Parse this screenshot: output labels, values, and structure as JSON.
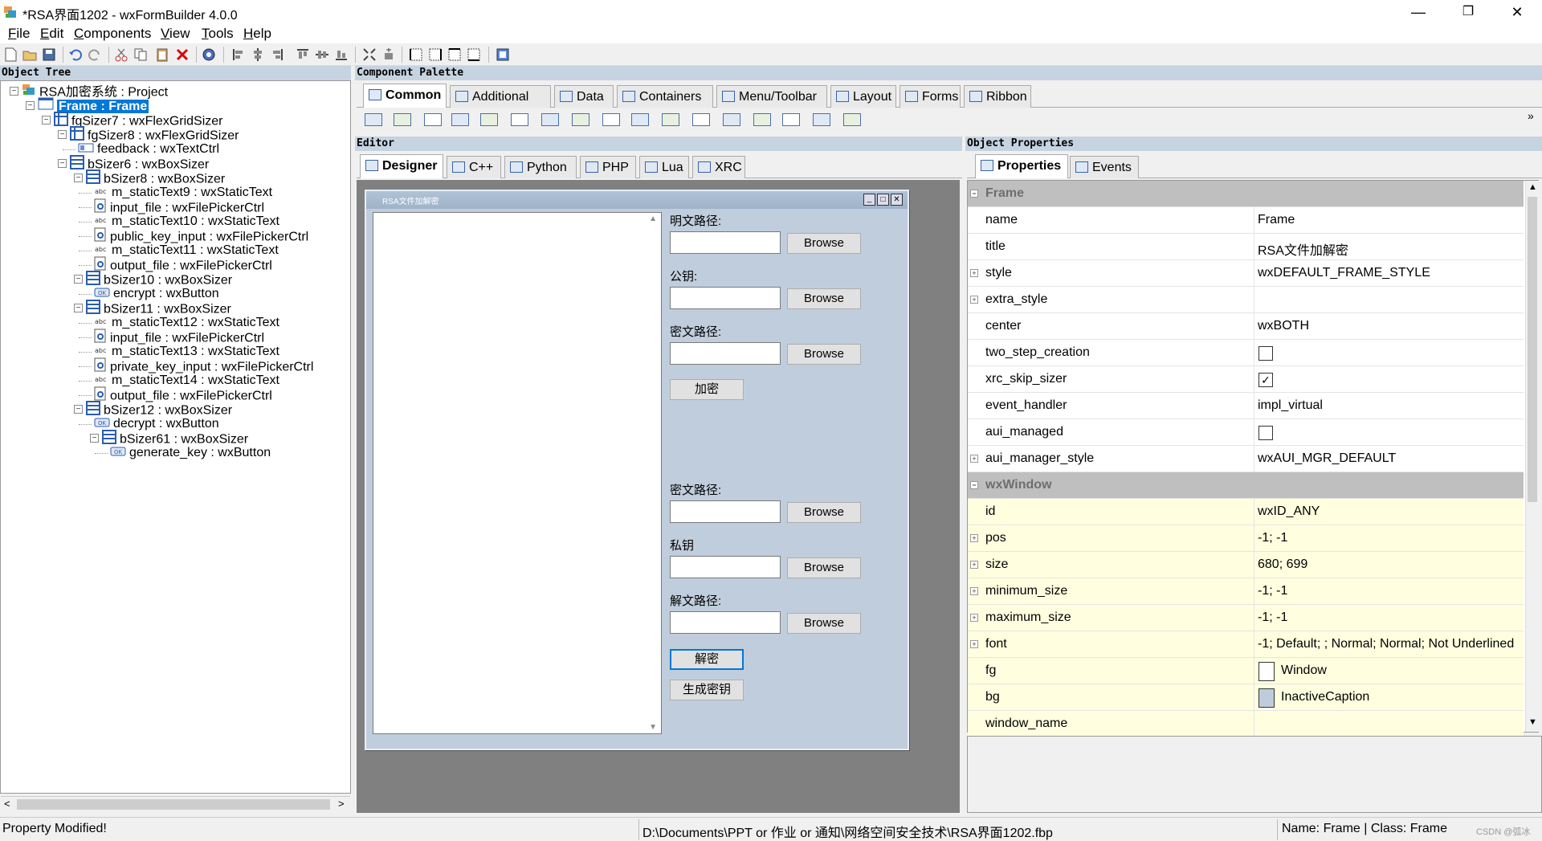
{
  "window": {
    "title": "*RSA界面1202 - wxFormBuilder 4.0.0",
    "min": "—",
    "max": "❐",
    "close": "✕"
  },
  "menu": [
    {
      "label": "File",
      "key": "F",
      "rest": "ile"
    },
    {
      "label": "Edit",
      "key": "E",
      "rest": "dit"
    },
    {
      "label": "Components",
      "key": "C",
      "rest": "omponents"
    },
    {
      "label": "View",
      "key": "V",
      "rest": "iew"
    },
    {
      "label": "Tools",
      "key": "T",
      "rest": "ools"
    },
    {
      "label": "Help",
      "key": "H",
      "rest": "elp"
    }
  ],
  "panels": {
    "object_tree": "Object Tree",
    "palette": "Component Palette",
    "editor": "Editor",
    "properties": "Object Properties"
  },
  "tree": [
    {
      "label": "RSA加密系统 : Project",
      "icon": "project-icon"
    },
    {
      "label": "Frame : Frame",
      "icon": "frame-icon"
    },
    {
      "label": "fgSizer7 : wxFlexGridSizer",
      "icon": "flexgrid-icon"
    },
    {
      "label": "fgSizer8 : wxFlexGridSizer",
      "icon": "flexgrid-icon"
    },
    {
      "label": "feedback : wxTextCtrl",
      "icon": "textctrl-icon"
    },
    {
      "label": "bSizer6 : wxBoxSizer",
      "icon": "boxsizer-icon"
    },
    {
      "label": "bSizer8 : wxBoxSizer",
      "icon": "boxsizer-icon"
    },
    {
      "label": "m_staticText9 : wxStaticText",
      "icon": "statictext-icon"
    },
    {
      "label": "input_file : wxFilePickerCtrl",
      "icon": "filepicker-icon"
    },
    {
      "label": "m_staticText10 : wxStaticText",
      "icon": "statictext-icon"
    },
    {
      "label": "public_key_input : wxFilePickerCtrl",
      "icon": "filepicker-icon"
    },
    {
      "label": "m_staticText11 : wxStaticText",
      "icon": "statictext-icon"
    },
    {
      "label": "output_file : wxFilePickerCtrl",
      "icon": "filepicker-icon"
    },
    {
      "label": "bSizer10 : wxBoxSizer",
      "icon": "boxsizer-icon"
    },
    {
      "label": "encrypt : wxButton",
      "icon": "button-icon"
    },
    {
      "label": "bSizer11 : wxBoxSizer",
      "icon": "boxsizer-icon"
    },
    {
      "label": "m_staticText12 : wxStaticText",
      "icon": "statictext-icon"
    },
    {
      "label": "input_file : wxFilePickerCtrl",
      "icon": "filepicker-icon"
    },
    {
      "label": "m_staticText13 : wxStaticText",
      "icon": "statictext-icon"
    },
    {
      "label": "private_key_input : wxFilePickerCtrl",
      "icon": "filepicker-icon"
    },
    {
      "label": "m_staticText14 : wxStaticText",
      "icon": "statictext-icon"
    },
    {
      "label": "output_file : wxFilePickerCtrl",
      "icon": "filepicker-icon"
    },
    {
      "label": "bSizer12 : wxBoxSizer",
      "icon": "boxsizer-icon"
    },
    {
      "label": "decrypt : wxButton",
      "icon": "button-icon"
    },
    {
      "label": "bSizer61 : wxBoxSizer",
      "icon": "boxsizer-icon"
    },
    {
      "label": "generate_key : wxButton",
      "icon": "button-icon"
    }
  ],
  "palette_tabs": [
    "Common",
    "Additional",
    "Data",
    "Containers",
    "Menu/Toolbar",
    "Layout",
    "Forms",
    "Ribbon"
  ],
  "palette_scroll": "»",
  "editor_tabs": [
    "Designer",
    "C++",
    "Python",
    "PHP",
    "Lua",
    "XRC"
  ],
  "design": {
    "frame_title": "RSA文件加解密",
    "frame_btns": [
      "_",
      "□",
      "✕"
    ],
    "labels": [
      "明文路径:",
      "公钥:",
      "密文路径:",
      "密文路径:",
      "私钥",
      "解文路径:"
    ],
    "browse": "Browse",
    "encrypt": "加密",
    "decrypt": "解密",
    "genkey": "生成密钥"
  },
  "prop_tabs": [
    "Properties",
    "Events"
  ],
  "props": [
    {
      "cat": "Frame"
    },
    {
      "name": "name",
      "value": "Frame"
    },
    {
      "name": "title",
      "value": "RSA文件加解密"
    },
    {
      "name": "style",
      "value": "wxDEFAULT_FRAME_STYLE",
      "plus": true
    },
    {
      "name": "extra_style",
      "value": "",
      "plus": true
    },
    {
      "name": "center",
      "value": "wxBOTH"
    },
    {
      "name": "two_step_creation",
      "check": false
    },
    {
      "name": "xrc_skip_sizer",
      "check": true
    },
    {
      "name": "event_handler",
      "value": "impl_virtual"
    },
    {
      "name": "aui_managed",
      "check": false
    },
    {
      "name": "aui_manager_style",
      "value": "wxAUI_MGR_DEFAULT",
      "plus": true
    },
    {
      "cat": "wxWindow"
    },
    {
      "name": "id",
      "value": "wxID_ANY",
      "yel": true
    },
    {
      "name": "pos",
      "value": "-1; -1",
      "yel": true,
      "plus": true
    },
    {
      "name": "size",
      "value": "680; 699",
      "yel": true,
      "plus": true
    },
    {
      "name": "minimum_size",
      "value": "-1; -1",
      "yel": true,
      "plus": true
    },
    {
      "name": "maximum_size",
      "value": "-1; -1",
      "yel": true,
      "plus": true
    },
    {
      "name": "font",
      "value": "-1; Default; ; Normal; Normal; Not Underlined",
      "yel": true,
      "plus": true
    },
    {
      "name": "fg",
      "value": "Window",
      "yel": true,
      "swatch": "#ffffff"
    },
    {
      "name": "bg",
      "value": "InactiveCaption",
      "yel": true,
      "swatch": "#bfcddb"
    },
    {
      "name": "window_name",
      "value": "",
      "yel": true
    }
  ],
  "status": {
    "left": "Property Modified!",
    "path": "D:\\Documents\\PPT or 作业 or 通知\\网络空间安全技术\\RSA界面1202.fbp",
    "info": "Name: Frame | Class: Frame",
    "watermark": "CSDN @弧冰"
  },
  "colors": {
    "accent": "#0078d7",
    "header": "#c6d3e1",
    "design_bg": "#808080",
    "frame_bg": "#c0cddc"
  }
}
